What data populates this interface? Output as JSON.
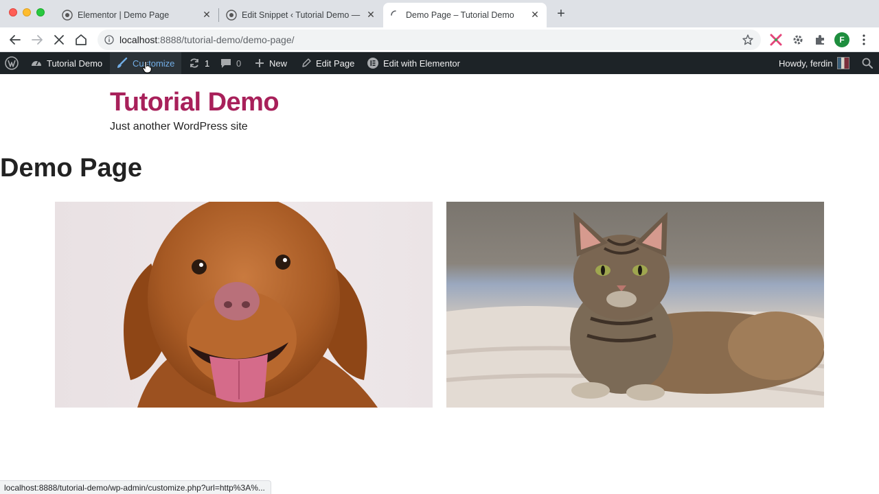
{
  "browser": {
    "tabs": [
      {
        "title": "Elementor | Demo Page",
        "active": false
      },
      {
        "title": "Edit Snippet ‹ Tutorial Demo —",
        "active": false
      },
      {
        "title": "Demo Page – Tutorial Demo",
        "active": true
      }
    ],
    "address": {
      "host": "localhost",
      "rest": ":8888/tutorial-demo/demo-page/"
    },
    "profile_initial": "F",
    "status_url": "localhost:8888/tutorial-demo/wp-admin/customize.php?url=http%3A%..."
  },
  "adminbar": {
    "site_name": "Tutorial Demo",
    "customize": "Customize",
    "updates_count": "1",
    "comments_count": "0",
    "new": "New",
    "edit_page": "Edit Page",
    "edit_elementor": "Edit with Elementor",
    "howdy": "Howdy, ferdin"
  },
  "site": {
    "title": "Tutorial Demo",
    "tagline": "Just another WordPress site"
  },
  "page": {
    "title": "Demo Page"
  },
  "colors": {
    "accent": "#a8205a",
    "adminbar_bg": "#1d2327",
    "customize_link": "#72aee6"
  }
}
